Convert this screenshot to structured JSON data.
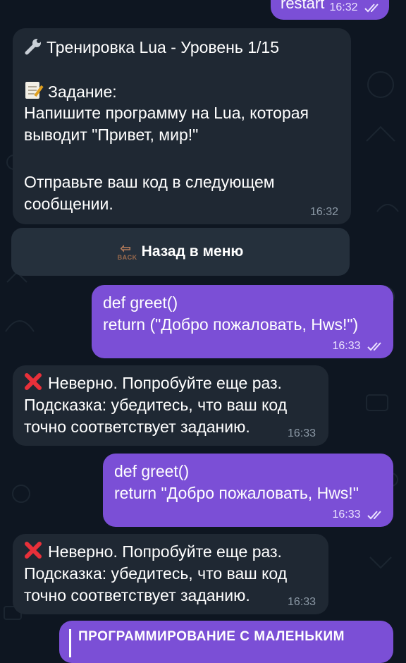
{
  "top_message": {
    "text": "restart",
    "time": "16:32"
  },
  "task_message": {
    "title": "Тренировка Lua - Уровень 1/15",
    "title_icon": "wrench-icon",
    "task_label": "Задание:",
    "task_icon": "memo-icon",
    "task_text": "Напишите программу на Lua, которая\nвыводит \"Привет, мир!\"",
    "footer": "Отправьте ваш код в следующем\nсообщении.",
    "time": "16:32"
  },
  "menu_button": {
    "label": "Назад в меню",
    "icon": "back-icon",
    "icon_text": "BACK"
  },
  "messages": [
    {
      "type": "out",
      "text": "def greet()\nreturn (\"Добро пожаловать, Hws!\")",
      "time": "16:33"
    },
    {
      "type": "in",
      "icon": "cross-mark-icon",
      "text": "Неверно. Попробуйте еще раз.\nПодсказка: убедитесь, что ваш код\nточно соответствует заданию.",
      "time": "16:33"
    },
    {
      "type": "out",
      "text": "def greet()\nreturn \"Добро пожаловать, Hws!\"",
      "time": "16:33"
    },
    {
      "type": "in",
      "icon": "cross-mark-icon",
      "text": "Неверно. Попробуйте еще раз.\nПодсказка: убедитесь, что ваш код\nточно соответствует заданию.",
      "time": "16:33"
    }
  ],
  "banner": {
    "text": "ПРОГРАММИРОВАНИЕ С МАЛЕНЬКИМ"
  },
  "colors": {
    "background": "#0e1621",
    "incoming": "#1f2833",
    "outgoing": "#7b4fd6",
    "time_in": "#8b98a5"
  }
}
